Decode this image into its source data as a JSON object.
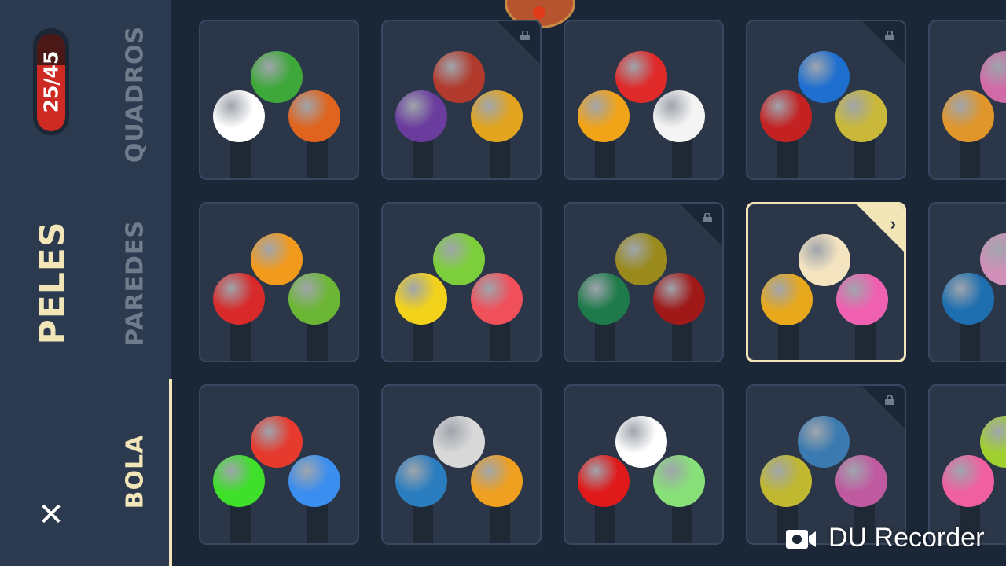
{
  "sidebar": {
    "title": "PELES",
    "progress": "25/45",
    "tabs": [
      {
        "label": "QUADROS",
        "active": false
      },
      {
        "label": "PAREDES",
        "active": false
      },
      {
        "label": "BOLA",
        "active": true
      }
    ],
    "close_icon": "close-icon"
  },
  "watermark": {
    "label": "DU Recorder"
  },
  "colors": {
    "accent": "#f2e6b8",
    "badge": "#cc2a22",
    "panel": "#2b3a4e",
    "card": "#2b3748"
  },
  "skins": [
    {
      "name": "sports",
      "locked": false,
      "selected": false,
      "balls": [
        "#3fa83a",
        "#ffffff",
        "#e0641e"
      ]
    },
    {
      "name": "emoji",
      "locked": true,
      "selected": false,
      "balls": [
        "#b23a2c",
        "#6a3c9e",
        "#e3a51f"
      ]
    },
    {
      "name": "flowers",
      "locked": false,
      "selected": false,
      "balls": [
        "#e02a2a",
        "#f2a418",
        "#f4f4f4"
      ]
    },
    {
      "name": "card-suits",
      "locked": true,
      "selected": false,
      "balls": [
        "#1e6fd0",
        "#c42222",
        "#c9b83a"
      ]
    },
    {
      "name": "candy-dots",
      "locked": false,
      "selected": false,
      "balls": [
        "#d26aa8",
        "#e0962a",
        "#444444"
      ]
    },
    {
      "name": "fruits",
      "locked": false,
      "selected": false,
      "balls": [
        "#f29a1c",
        "#d82a2a",
        "#6cb636"
      ]
    },
    {
      "name": "sweets",
      "locked": false,
      "selected": false,
      "balls": [
        "#7ccf3a",
        "#f2d21a",
        "#f0505a"
      ]
    },
    {
      "name": "bugs",
      "locked": true,
      "selected": false,
      "balls": [
        "#9a8a1c",
        "#1e7a4a",
        "#a01818"
      ]
    },
    {
      "name": "desserts",
      "locked": false,
      "selected": true,
      "balls": [
        "#f4e4c0",
        "#e8a81c",
        "#f060b0"
      ]
    },
    {
      "name": "animals",
      "locked": false,
      "selected": false,
      "balls": [
        "#d090b8",
        "#1e6fb0",
        "#333333"
      ]
    },
    {
      "name": "basic-colors",
      "locked": false,
      "selected": false,
      "balls": [
        "#e63a2e",
        "#3ee02a",
        "#3a8ef0"
      ]
    },
    {
      "name": "planets",
      "locked": false,
      "selected": false,
      "balls": [
        "#d8d8d8",
        "#2a7ec0",
        "#f0a020"
      ]
    },
    {
      "name": "spooky",
      "locked": false,
      "selected": false,
      "balls": [
        "#ffffff",
        "#e01a1a",
        "#88e078"
      ]
    },
    {
      "name": "gems",
      "locked": true,
      "selected": false,
      "balls": [
        "#3a7ab0",
        "#c0b830",
        "#c05aa0"
      ]
    },
    {
      "name": "donuts",
      "locked": false,
      "selected": false,
      "balls": [
        "#a0d030",
        "#f060a0",
        "#444444"
      ]
    }
  ]
}
